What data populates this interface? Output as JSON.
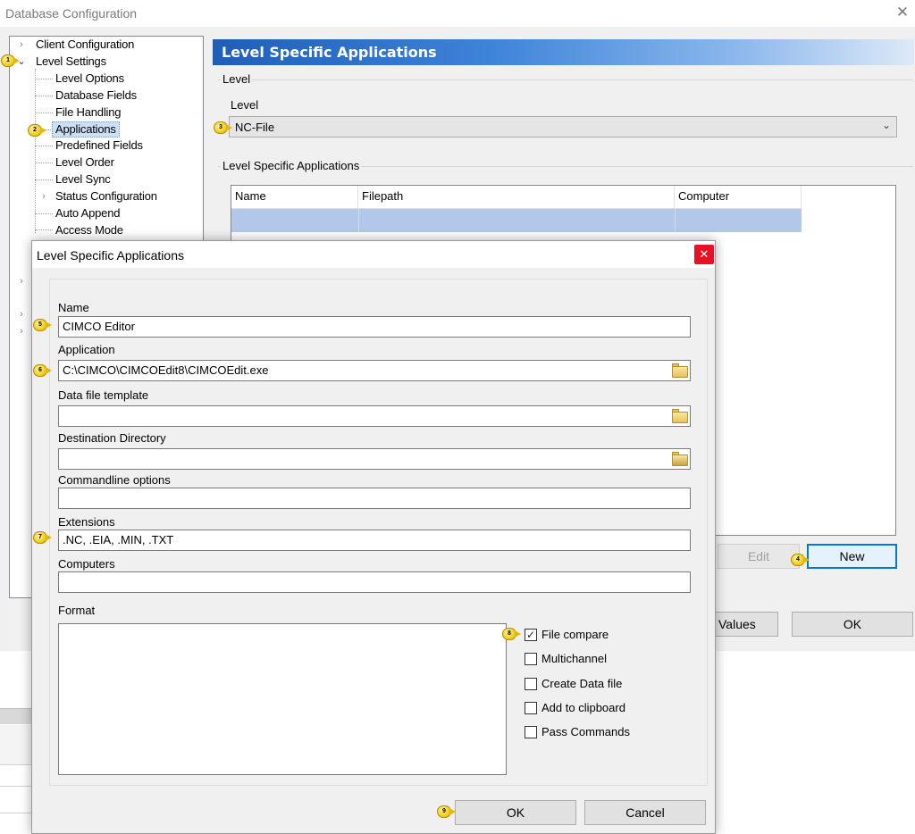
{
  "outer_window": {
    "title": "Database Configuration",
    "close_glyph": "✕",
    "tree": {
      "items": [
        {
          "label": "Client Configuration",
          "expander": "›"
        },
        {
          "label": "Level Settings",
          "expander": "⌄"
        },
        {
          "label": "Level Options"
        },
        {
          "label": "Database Fields"
        },
        {
          "label": "File Handling"
        },
        {
          "label": "Applications",
          "selected": true
        },
        {
          "label": "Predefined Fields"
        },
        {
          "label": "Level Order"
        },
        {
          "label": "Level Sync"
        },
        {
          "label": "Status Configuration",
          "expander": "›"
        },
        {
          "label": "Auto Append"
        },
        {
          "label": "Access Mode"
        }
      ],
      "hidden_expanders": [
        "›",
        "›",
        "›"
      ]
    },
    "panel": {
      "header_title": "Level Specific Applications",
      "level_group_label": "Level",
      "level_field_label": "Level",
      "level_value": "NC-File",
      "level_chevron": "⌄",
      "apps_group_label": "Level Specific Applications",
      "columns": [
        "Name",
        "Filepath",
        "Computer"
      ],
      "edit_button": "Edit",
      "new_button": "New",
      "default_values_button_partial": "t Values",
      "ok_button": "OK"
    }
  },
  "dialog": {
    "title": "Level Specific Applications",
    "close_glyph": "✕",
    "fields": {
      "name": {
        "label": "Name",
        "value": "CIMCO Editor"
      },
      "application": {
        "label": "Application",
        "value": "C:\\CIMCO\\CIMCOEdit8\\CIMCOEdit.exe"
      },
      "data_file_template": {
        "label": "Data file template",
        "value": ""
      },
      "destination_directory": {
        "label": "Destination Directory",
        "value": ""
      },
      "commandline_options": {
        "label": "Commandline options",
        "value": ""
      },
      "extensions": {
        "label": "Extensions",
        "value": ".NC, .EIA, .MIN, .TXT"
      },
      "computers": {
        "label": "Computers",
        "value": ""
      },
      "format": {
        "label": "Format",
        "value": ""
      }
    },
    "checkboxes": [
      {
        "label": "File compare",
        "checked": true,
        "mark": "✓"
      },
      {
        "label": "Multichannel",
        "checked": false,
        "mark": ""
      },
      {
        "label": "Create Data file",
        "checked": false,
        "mark": ""
      },
      {
        "label": "Add to clipboard",
        "checked": false,
        "mark": ""
      },
      {
        "label": "Pass Commands",
        "checked": false,
        "mark": ""
      }
    ],
    "ok_button": "OK",
    "cancel_button": "Cancel"
  },
  "markers": [
    "1",
    "2",
    "3",
    "4",
    "5",
    "6",
    "7",
    "8",
    "9"
  ],
  "colors": {
    "header_gradient_start": "#1f5eb8",
    "selection_row": "#b3c8e8",
    "close_button": "#e81123",
    "marker": "#f2cd1d",
    "focus_border": "#0078d7"
  }
}
